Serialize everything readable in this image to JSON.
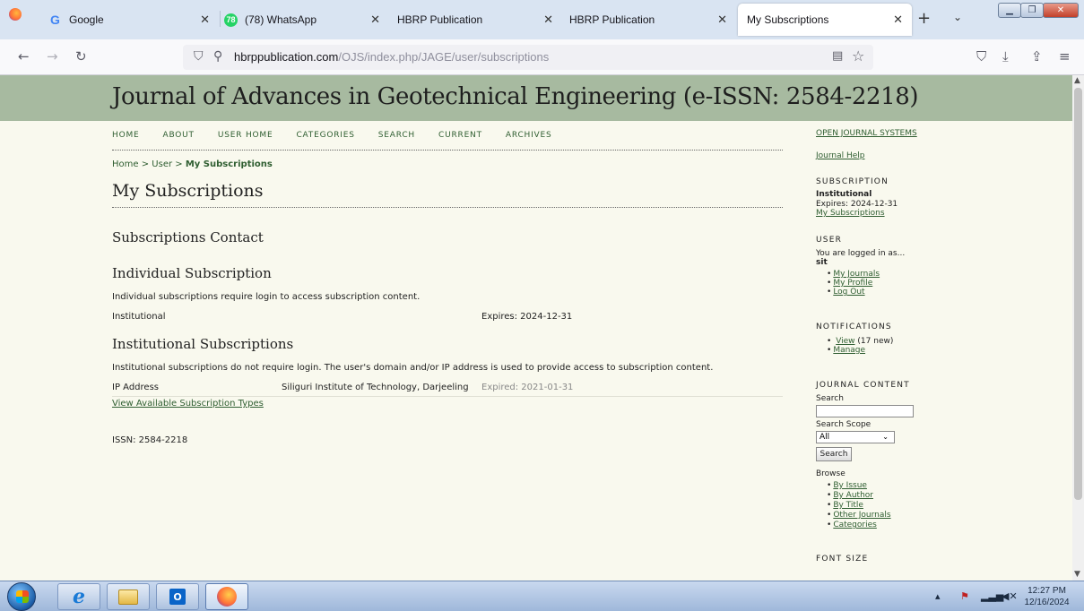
{
  "browser": {
    "tabs": [
      {
        "label": "Google",
        "favicon": "google-icon"
      },
      {
        "label": "(78) WhatsApp",
        "favicon": "whatsapp-icon",
        "badge": "78"
      },
      {
        "label": "HBRP Publication",
        "favicon": "none"
      },
      {
        "label": "HBRP Publication",
        "favicon": "none"
      },
      {
        "label": "My Subscriptions",
        "favicon": "none",
        "active": true
      }
    ],
    "url_domain": "hbrppublication.com",
    "url_path": "/OJS/index.php/JAGE/user/subscriptions"
  },
  "page": {
    "journal_title": "Journal of Advances in Geotechnical Engineering (e-ISSN: 2584-2218)",
    "nav": [
      "HOME",
      "ABOUT",
      "USER HOME",
      "CATEGORIES",
      "SEARCH",
      "CURRENT",
      "ARCHIVES"
    ],
    "breadcrumb": {
      "home": "Home",
      "sep": ">",
      "user": "User",
      "current": "My Subscriptions"
    },
    "heading": "My Subscriptions",
    "contact_heading": "Subscriptions Contact",
    "individual": {
      "heading": "Individual Subscription",
      "description": "Individual subscriptions require login to access subscription content.",
      "type": "Institutional",
      "expires": "Expires: 2024-12-31"
    },
    "institutional": {
      "heading": "Institutional Subscriptions",
      "description": "Institutional subscriptions do not require login. The user's domain and/or IP address is used to provide access to subscription content.",
      "type": "IP Address",
      "institution": "Siliguri Institute of Technology, Darjeeling",
      "expired": "Expired: 2021-01-31",
      "view_link": "View Available Subscription Types"
    },
    "issn": "ISSN: 2584-2218"
  },
  "sidebar": {
    "ojs_link": "OPEN JOURNAL SYSTEMS",
    "help_link": "Journal Help",
    "subscription": {
      "title": "SUBSCRIPTION",
      "type": "Institutional",
      "expires": "Expires: 2024-12-31",
      "link": "My Subscriptions"
    },
    "user": {
      "title": "USER",
      "logged_in": "You are logged in as...",
      "username": "sit",
      "links": [
        "My Journals",
        "My Profile",
        "Log Out"
      ]
    },
    "notifications": {
      "title": "NOTIFICATIONS",
      "view": "View",
      "view_count": "(17 new)",
      "manage": "Manage"
    },
    "journal_content": {
      "title": "JOURNAL CONTENT",
      "search_label": "Search",
      "scope_label": "Search Scope",
      "scope_value": "All",
      "search_button": "Search",
      "browse_label": "Browse",
      "browse_links": [
        "By Issue",
        "By Author",
        "By Title",
        "Other Journals",
        "Categories"
      ]
    },
    "font_size_title": "FONT SIZE"
  },
  "taskbar": {
    "time": "12:27 PM",
    "date": "12/16/2024"
  },
  "colors": {
    "header_bg": "#a7baa0",
    "page_bg": "#f9f9ee",
    "link": "#2f5e31"
  }
}
